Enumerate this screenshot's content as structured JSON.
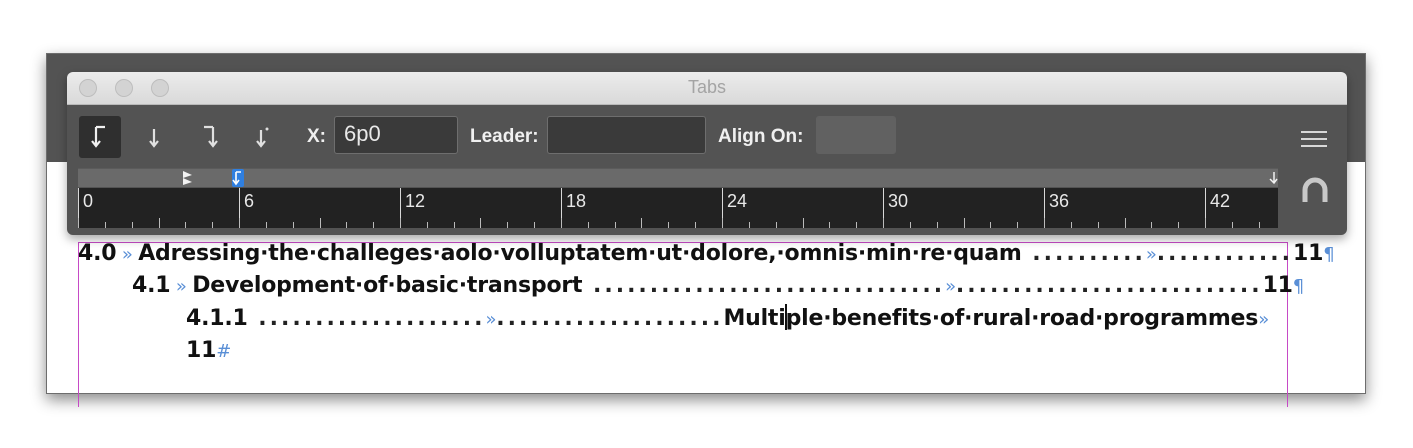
{
  "panel": {
    "title": "Tabs",
    "x_label": "X:",
    "x_value": "6p0",
    "leader_label": "Leader:",
    "leader_value": "",
    "align_on_label": "Align On:",
    "align_on_value": ""
  },
  "ruler": {
    "labels": [
      "0",
      "6",
      "12",
      "18",
      "24",
      "30",
      "36",
      "42"
    ]
  },
  "toc": {
    "line1": {
      "number": "4.0",
      "text": "Adressing·the·challeges·aolo·volluptatem·ut·dolore,·omnis·min·re·quam",
      "page": "11"
    },
    "line2": {
      "number": "4.1",
      "text": "Development·of·basic·transport",
      "page": "11"
    },
    "line3": {
      "number": "4.1.1",
      "text_before_cursor": "Multi",
      "text_after_cursor": "ple·benefits·of·rural·road·programmes",
      "page": "11"
    }
  },
  "colors": {
    "panel_bg": "#535353",
    "frame_border": "#c64ac6",
    "hidden_char": "#5a8fd6"
  }
}
